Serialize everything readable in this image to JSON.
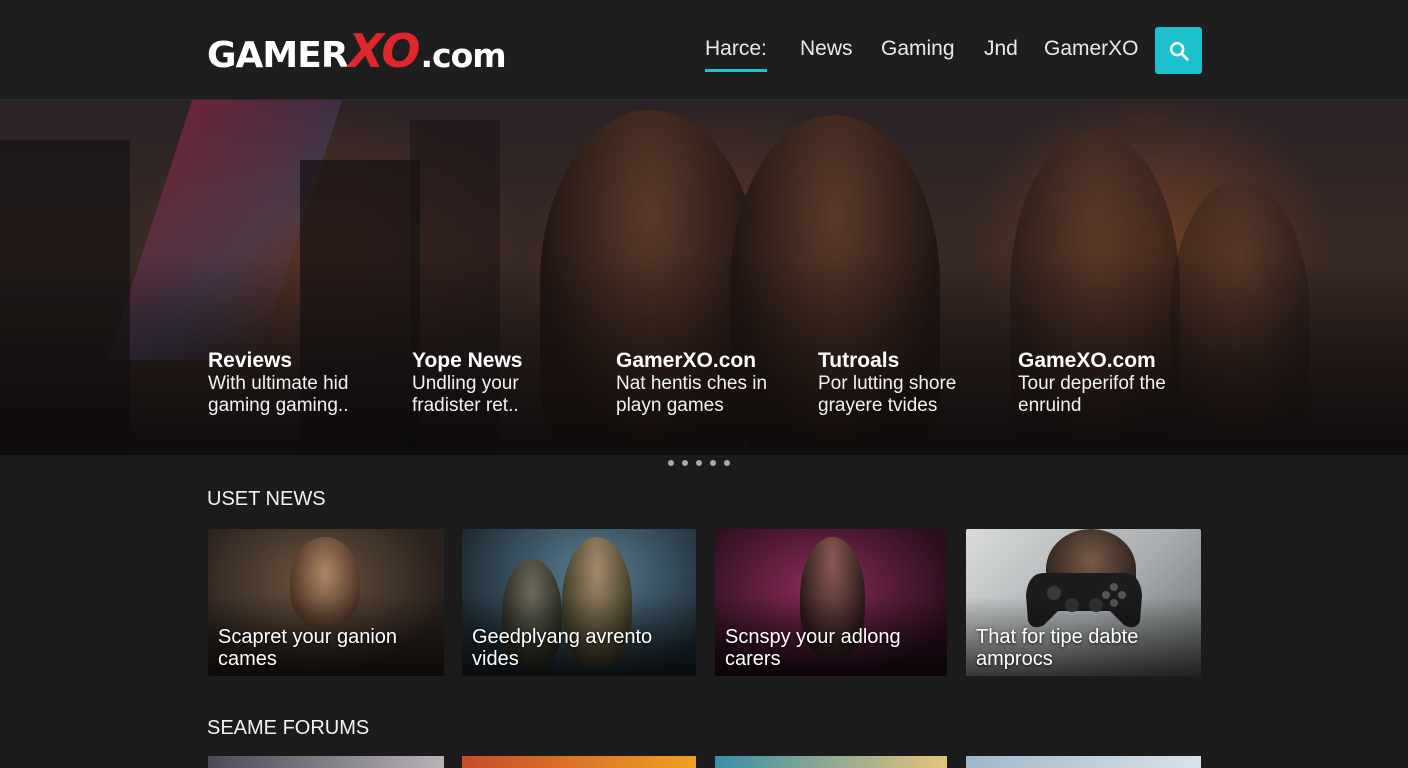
{
  "header": {
    "logo": {
      "part1": "GAMER",
      "part2": "XO",
      "part3": ".com"
    },
    "nav": [
      {
        "label": "Harce:",
        "active": true
      },
      {
        "label": "News",
        "active": false
      },
      {
        "label": "Gaming",
        "active": false
      },
      {
        "label": "Jnd",
        "active": false
      },
      {
        "label": "GamerXO",
        "active": false
      }
    ],
    "search_icon": "search-icon",
    "accent_color": "#1cc1cd"
  },
  "hero": {
    "captions": [
      {
        "title": "Reviews",
        "lines": [
          "With ultimate hid",
          "gaming gaming.."
        ]
      },
      {
        "title": "Yope News",
        "lines": [
          "Undling your",
          "fradister ret.."
        ]
      },
      {
        "title": "GamerXO.con",
        "lines": [
          "Nat hentis ches in",
          "playn games"
        ]
      },
      {
        "title": "Tutroals",
        "lines": [
          "Por lutting shore",
          "grayere tvides"
        ]
      },
      {
        "title": "GameXO.com",
        "lines": [
          "Tour deperifof the",
          "enruind"
        ]
      }
    ],
    "slide_count": 5
  },
  "latest_news": {
    "title": "USET NEWS",
    "cards": [
      {
        "lines": [
          "Scapret your ganion",
          "cames"
        ]
      },
      {
        "lines": [
          "Geedplyang avrento",
          "vides"
        ]
      },
      {
        "lines": [
          "Scnspy your adlong",
          "carers"
        ]
      },
      {
        "lines": [
          "That for tipe dabte",
          "amprocs"
        ]
      }
    ]
  },
  "forums": {
    "title": "SEAME FORUMS"
  }
}
